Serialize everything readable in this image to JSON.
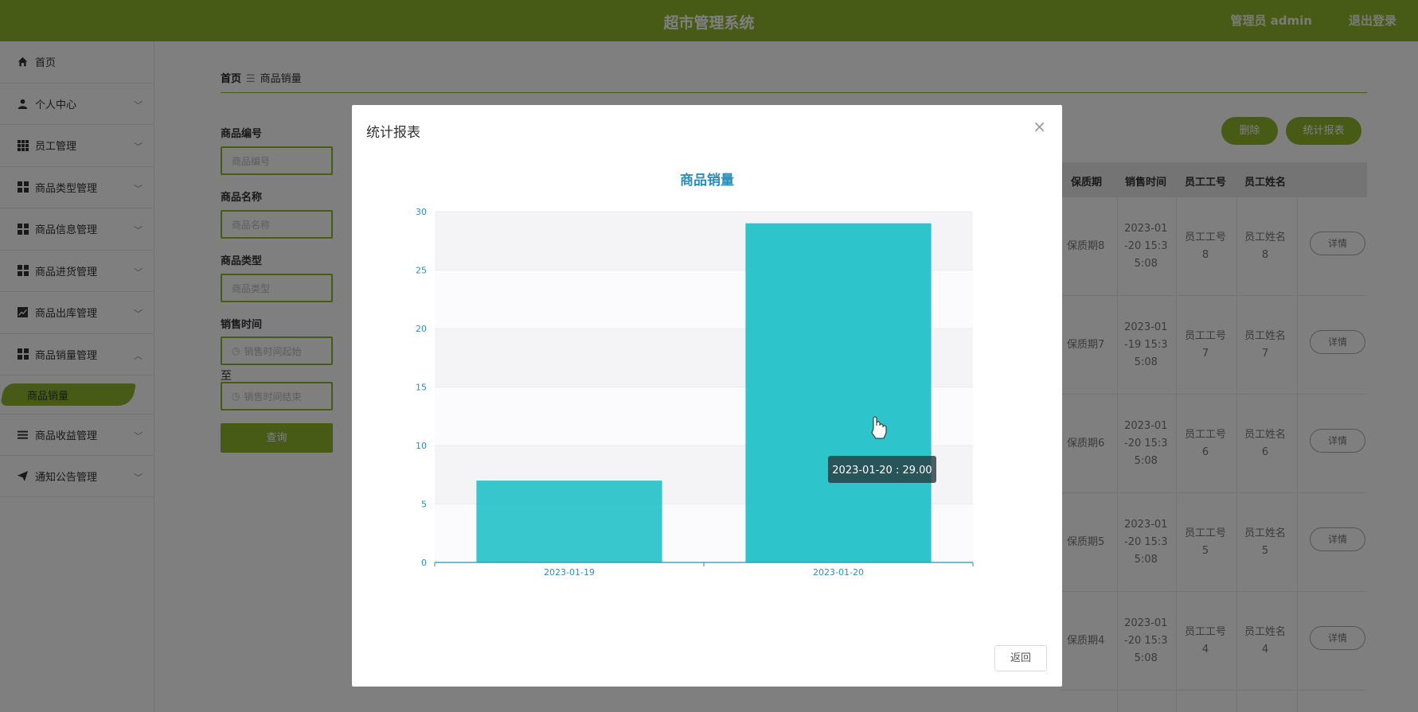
{
  "header": {
    "title": "超市管理系统",
    "admin": "管理员 admin",
    "logout": "退出登录"
  },
  "sidebar": {
    "items": [
      {
        "label": "首页",
        "icon": "home-icon"
      },
      {
        "label": "个人中心",
        "icon": "user-icon"
      },
      {
        "label": "员工管理",
        "icon": "grid-icon"
      },
      {
        "label": "商品类型管理",
        "icon": "grid-icon"
      },
      {
        "label": "商品信息管理",
        "icon": "grid-icon"
      },
      {
        "label": "商品进货管理",
        "icon": "grid-icon"
      },
      {
        "label": "商品出库管理",
        "icon": "chart-icon"
      },
      {
        "label": "商品销量管理",
        "icon": "grid-icon"
      },
      {
        "label": "商品收益管理",
        "icon": "list-icon"
      },
      {
        "label": "通知公告管理",
        "icon": "send-icon"
      }
    ],
    "active_sub": "商品销量"
  },
  "breadcrumb": {
    "home": "首页",
    "sep": "☰",
    "current": "商品销量"
  },
  "search": {
    "code_label": "商品编号",
    "code_placeholder": "商品编号",
    "name_label": "商品名称",
    "name_placeholder": "商品名称",
    "type_label": "商品类型",
    "type_placeholder": "商品类型",
    "time_label": "销售时间",
    "time_start_placeholder": "销售时间起始",
    "to_label": "至",
    "time_end_placeholder": "销售时间结束",
    "query_button": "查询"
  },
  "actions": {
    "delete": "删除",
    "report": "统计报表"
  },
  "table": {
    "headers": [
      "保质期",
      "销售时间",
      "员工工号",
      "员工姓名"
    ],
    "rows": [
      {
        "shelf": "保质期8",
        "time": [
          "2023-01",
          "-20 15:3",
          "5:08"
        ],
        "emp_no": [
          "员工工号",
          "8"
        ],
        "emp_name": [
          "员工姓名",
          "8"
        ],
        "action": "详情"
      },
      {
        "shelf": "保质期7",
        "time": [
          "2023-01",
          "-19 15:3",
          "5:08"
        ],
        "emp_no": [
          "员工工号",
          "7"
        ],
        "emp_name": [
          "员工姓名",
          "7"
        ],
        "action": "详情"
      },
      {
        "shelf": "保质期6",
        "time": [
          "2023-01",
          "-20 15:3",
          "5:08"
        ],
        "emp_no": [
          "员工工号",
          "6"
        ],
        "emp_name": [
          "员工姓名",
          "6"
        ],
        "action": "详情"
      },
      {
        "shelf": "保质期5",
        "time": [
          "2023-01",
          "-20 15:3",
          "5:08"
        ],
        "emp_no": [
          "员工工号",
          "5"
        ],
        "emp_name": [
          "员工姓名",
          "5"
        ],
        "action": "详情"
      },
      {
        "shelf": "保质期4",
        "time": [
          "2023-01",
          "-20 15:3",
          "5:08"
        ],
        "emp_no": [
          "员工工号",
          "4"
        ],
        "emp_name": [
          "员工姓名",
          "4"
        ],
        "action": "详情"
      }
    ]
  },
  "dialog": {
    "title": "统计报表",
    "close": "×",
    "back_button": "返回",
    "tooltip": "2023-01-20 : 29.00"
  },
  "chart_data": {
    "type": "bar",
    "title": "商品销量",
    "categories": [
      "2023-01-19",
      "2023-01-20"
    ],
    "values": [
      7,
      29
    ],
    "ylim": [
      0,
      30
    ],
    "yticks": [
      0,
      5,
      10,
      15,
      20,
      25,
      30
    ],
    "xlabel": "",
    "ylabel": "",
    "grid": true,
    "bar_color": "#22c1c8",
    "axis_color": "#2a8fb9"
  }
}
